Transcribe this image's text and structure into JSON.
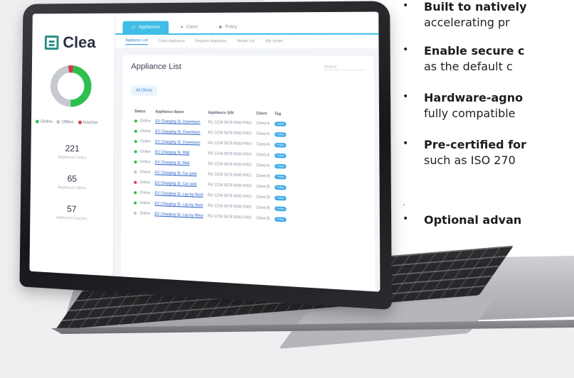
{
  "app": {
    "name": "Clea",
    "tabs": [
      {
        "label": "Appliances"
      },
      {
        "label": "Client"
      },
      {
        "label": "Policy"
      }
    ],
    "subnav": [
      "Appliance List",
      "Claim Appliance",
      "Register Appliance",
      "Model List",
      "Bin center"
    ],
    "page_title": "Appliance List",
    "search_placeholder": "Search",
    "filter_chip": "All Clients",
    "legend": [
      "Online",
      "Offline",
      "Inactive"
    ],
    "stats": [
      {
        "value": "221",
        "label": "Appliances Online"
      },
      {
        "value": "65",
        "label": "Appliances Offline"
      },
      {
        "value": "57",
        "label": "Appliances Inactive"
      }
    ],
    "donut": {
      "online_pct": 0.5,
      "offline_pct": 0.5
    },
    "colors": {
      "accent": "#3fbde6",
      "online": "#2fbf4f",
      "offline": "#bfc3c9",
      "alert": "#e0344a"
    },
    "table": {
      "headers": [
        "Status",
        "Appliance Name",
        "Appliance S/N",
        "Client",
        "Tag"
      ],
      "rows": [
        {
          "status": "Online",
          "name": "EV Charging St. Downtown",
          "sn": "RU 1234 5678 9000 PRO",
          "client": "Client A",
          "tag": "Public",
          "dot": "online"
        },
        {
          "status": "Online",
          "name": "EV Charging St. Downtown",
          "sn": "RU 1234 5678 9000 PRO",
          "client": "Client A",
          "tag": "Public",
          "dot": "online"
        },
        {
          "status": "Online",
          "name": "EV Charging St. Downtown",
          "sn": "RU 1234 5678 9000 PRO",
          "client": "Client A",
          "tag": "Public",
          "dot": "online"
        },
        {
          "status": "Online",
          "name": "EV Charging St. Mall",
          "sn": "RU 1234 5678 9000 PRO",
          "client": "Client A",
          "tag": "Public",
          "dot": "online"
        },
        {
          "status": "Online",
          "name": "EV Charging St. Mall",
          "sn": "RU 1234 5678 9000 PRO",
          "client": "Client A",
          "tag": "Public",
          "dot": "online"
        },
        {
          "status": "Online",
          "name": "EV Charging St. Car park",
          "sn": "RU 1234 5678 9000 PRO",
          "client": "Client B",
          "tag": "Public",
          "dot": "offline"
        },
        {
          "status": "Online",
          "name": "EV Charging St. Car park",
          "sn": "RU 1234 5678 9000 PRO",
          "client": "Client B",
          "tag": "Public",
          "dot": "alert"
        },
        {
          "status": "Online",
          "name": "EV Charging St. Lay-by Nord",
          "sn": "RU 1234 5678 9000 PRO",
          "client": "Client B",
          "tag": "Public",
          "dot": "online"
        },
        {
          "status": "Online",
          "name": "EV Charging St. Lay-by Nord",
          "sn": "RU 1234 5678 9000 PRO",
          "client": "Client B",
          "tag": "Public",
          "dot": "online"
        },
        {
          "status": "Online",
          "name": "EV Charging St. Lay-by West",
          "sn": "RU 1234 5678 9000 PRO",
          "client": "Client B",
          "tag": "Public",
          "dot": "offline"
        }
      ]
    }
  },
  "bullets": [
    {
      "head": "Built to natively",
      "rest": "accelerating pr"
    },
    {
      "head": "Enable secure c",
      "rest": "as the default c"
    },
    {
      "head": "Hardware-agno",
      "rest": "fully compatible"
    },
    {
      "head": "Pre-certified for",
      "rest": "such as ISO 270"
    },
    {
      "head": "Optional advan",
      "rest": ""
    }
  ],
  "stray_mark": "."
}
